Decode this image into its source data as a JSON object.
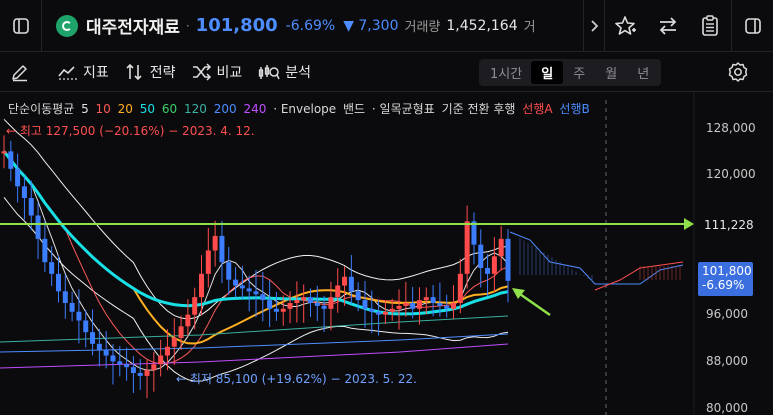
{
  "header": {
    "stock_name": "대주전자재료",
    "price": "101,800",
    "change_pct": "-6.69%",
    "change_amt": "▼ 7,300",
    "volume_label": "거래량",
    "volume": "1,452,164",
    "truncated": "거"
  },
  "toolbar": {
    "indicator_label": "지표",
    "strategy_label": "전략",
    "compare_label": "비교",
    "analysis_label": "분석"
  },
  "timeframes": [
    {
      "label": "1시간",
      "active": false
    },
    {
      "label": "일",
      "active": true
    },
    {
      "label": "주",
      "active": false
    },
    {
      "label": "월",
      "active": false
    },
    {
      "label": "년",
      "active": false
    }
  ],
  "legend": {
    "sma_label": "단순이동평균",
    "periods": [
      {
        "label": "5",
        "color": "#e0e0e0"
      },
      {
        "label": "10",
        "color": "#ff5a5a"
      },
      {
        "label": "20",
        "color": "#ffb020"
      },
      {
        "label": "50",
        "color": "#19e0e6"
      },
      {
        "label": "60",
        "color": "#3ad06a"
      },
      {
        "label": "120",
        "color": "#3ab0a0"
      },
      {
        "label": "200",
        "color": "#4d8dff"
      },
      {
        "label": "240",
        "color": "#c04dff"
      }
    ],
    "envelope": "· Envelope",
    "band": "밴드",
    "ichimoku": "· 일목균형표",
    "ichimoku_lines": "기준 전환 후행",
    "span_a": "선행A",
    "span_b": "선행B"
  },
  "annotations": {
    "max": "← 최고 127,500 (−20.16%) − 2023. 4. 12.",
    "min": "← 최저 85,100 (+19.62%) − 2023. 5. 22."
  },
  "price_axis": {
    "ticks": [
      "128,000",
      "120,000",
      "111,228",
      "96,000",
      "88,000",
      "80,000"
    ],
    "last_price": "101,800",
    "last_pct": "-6.69%",
    "line_level": "111,228"
  },
  "colors": {
    "up": "#ff4b4b",
    "down": "#3d7dff",
    "accent_blue": "#4d8dff",
    "hline": "#8fe04a",
    "arrow": "#8fe04a"
  },
  "chart_data": {
    "type": "candlestick",
    "y_axis_range": [
      80000,
      131000
    ],
    "horizontal_line": 111228,
    "last_price": 101800,
    "max_price": 127500,
    "min_price": 85100
  }
}
